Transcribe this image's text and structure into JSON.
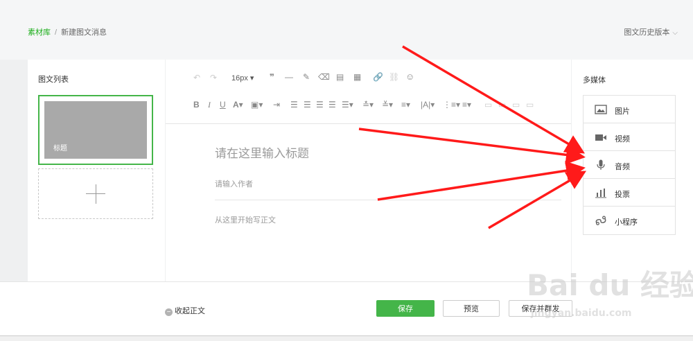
{
  "breadcrumb": {
    "root": "素材库",
    "separator": "/",
    "current": "新建图文消息"
  },
  "history": {
    "label": "图文历史版本"
  },
  "left_panel": {
    "title": "图文列表",
    "cards": [
      {
        "title": "标题"
      }
    ]
  },
  "toolbar": {
    "font_size": "16px"
  },
  "editor": {
    "title_placeholder": "请在这里输入标题",
    "author_placeholder": "请输入作者",
    "body_placeholder": "从这里开始写正文"
  },
  "right_panel": {
    "title": "多媒体",
    "items": [
      {
        "label": "图片",
        "icon": "image-icon"
      },
      {
        "label": "视频",
        "icon": "video-icon"
      },
      {
        "label": "音频",
        "icon": "microphone-icon"
      },
      {
        "label": "投票",
        "icon": "bar-chart-icon"
      },
      {
        "label": "小程序",
        "icon": "mini-program-icon"
      }
    ]
  },
  "footer": {
    "collapse_label": "收起正文",
    "save_label": "保存",
    "preview_label": "预览",
    "save_send_label": "保存并群发"
  },
  "watermark": {
    "brand": "Bai du 经验",
    "url": "jingyan.baidu.com"
  },
  "colors": {
    "accent": "#44b549",
    "link": "#1aad19",
    "annotation_arrow": "#ff1a1a"
  }
}
